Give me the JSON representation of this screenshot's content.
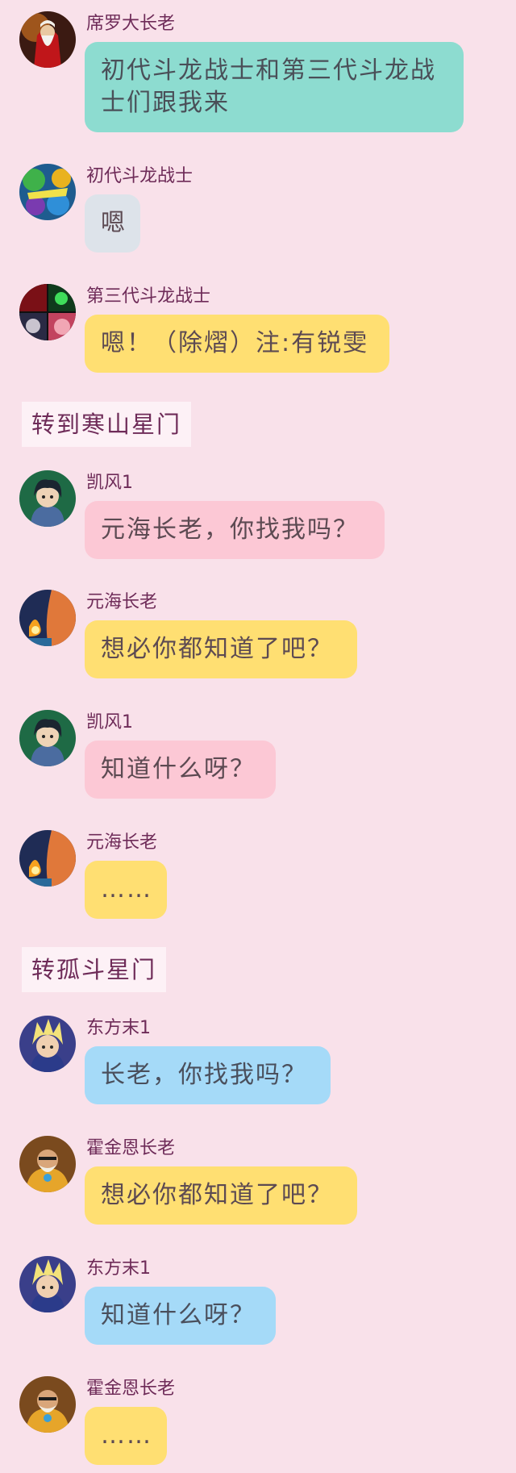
{
  "scenes": [
    {
      "label": "转到寒山星门"
    },
    {
      "label": "转孤斗星门"
    }
  ],
  "messages": [
    {
      "sender": "席罗大长老",
      "text": "初代斗龙战士和第三代斗龙战士们跟我来",
      "color": "#8ddcd0",
      "avatar_icon": "elder-xiluo-avatar"
    },
    {
      "sender": "初代斗龙战士",
      "text": "嗯",
      "color": "#dde3ea",
      "avatar_icon": "first-gen-warriors-avatar"
    },
    {
      "sender": "第三代斗龙战士",
      "text": "嗯！（除熠）注:有锐雯",
      "color": "#ffdf72",
      "avatar_icon": "third-gen-warriors-avatar"
    },
    {
      "sender": "凯风1",
      "text": "元海长老，你找我吗？",
      "color": "#fcc8d5",
      "avatar_icon": "kaifeng-avatar"
    },
    {
      "sender": "元海长老",
      "text": "想必你都知道了吧？",
      "color": "#ffdf72",
      "avatar_icon": "elder-yuanhai-avatar"
    },
    {
      "sender": "凯风1",
      "text": "知道什么呀？",
      "color": "#fcc8d5",
      "avatar_icon": "kaifeng-avatar"
    },
    {
      "sender": "元海长老",
      "text": "……",
      "color": "#ffdf72",
      "avatar_icon": "elder-yuanhai-avatar"
    },
    {
      "sender": "东方末1",
      "text": "长老，你找我吗？",
      "color": "#a5daf8",
      "avatar_icon": "dongfangmo-avatar"
    },
    {
      "sender": "霍金恩长老",
      "text": "想必你都知道了吧？",
      "color": "#ffdf72",
      "avatar_icon": "elder-huojinen-avatar"
    },
    {
      "sender": "东方末1",
      "text": "知道什么呀？",
      "color": "#a5daf8",
      "avatar_icon": "dongfangmo-avatar"
    },
    {
      "sender": "霍金恩长老",
      "text": "……",
      "color": "#ffdf72",
      "avatar_icon": "elder-huojinen-avatar"
    }
  ]
}
